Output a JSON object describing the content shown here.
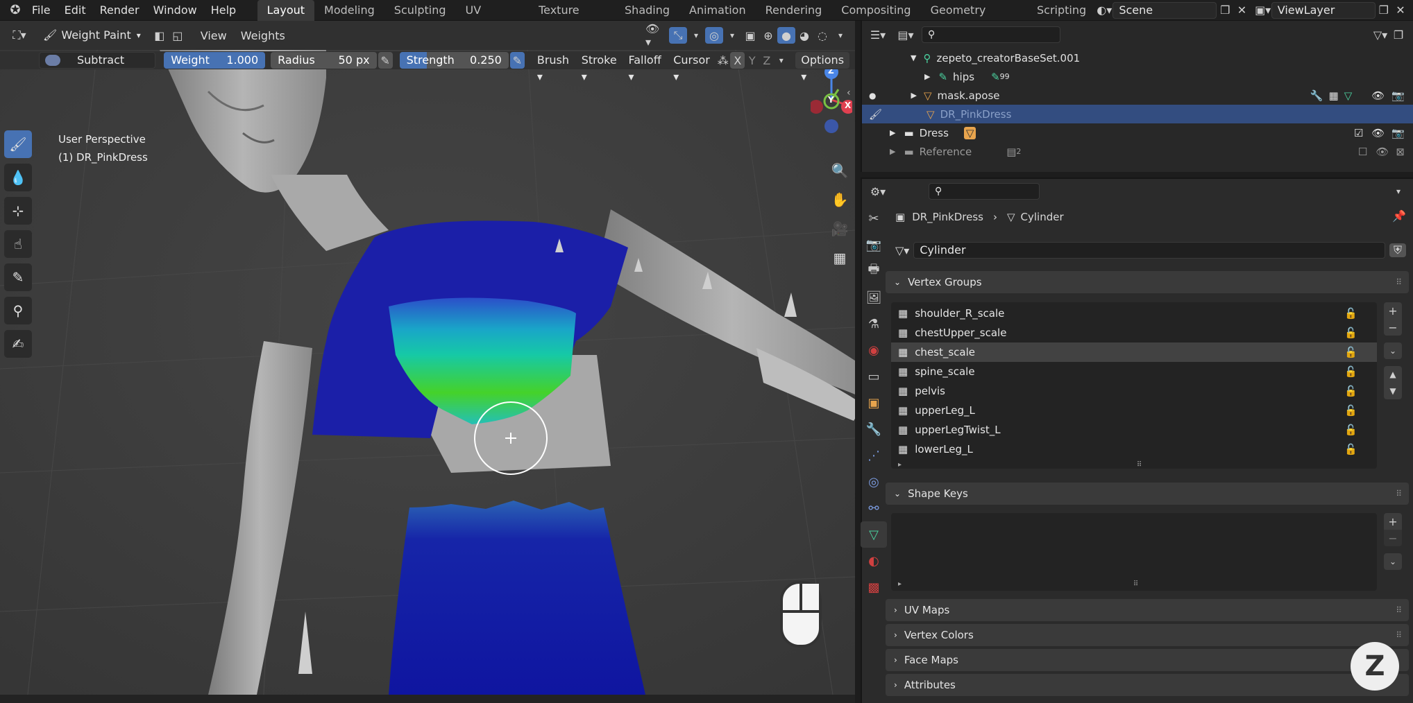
{
  "topbar": {
    "menus": [
      "File",
      "Edit",
      "Render",
      "Window",
      "Help"
    ],
    "workspaces": [
      "Layout",
      "Modeling",
      "Sculpting",
      "UV Editing",
      "Texture Paint",
      "Shading",
      "Animation",
      "Rendering",
      "Compositing",
      "Geometry Nodes",
      "Scripting"
    ],
    "scene": "Scene",
    "view_layer": "ViewLayer"
  },
  "viewport_header": {
    "mode": "Weight Paint",
    "menus": [
      "View",
      "Weights"
    ]
  },
  "tool_settings": {
    "blend": "Subtract",
    "weight_label": "Weight",
    "weight_value": "1.000",
    "radius_label": "Radius",
    "radius_value": "50 px",
    "strength_label": "Strength",
    "strength_value": "0.250",
    "dropdowns": [
      "Brush",
      "Stroke",
      "Falloff",
      "Cursor"
    ],
    "axes": [
      "X",
      "Y",
      "Z"
    ],
    "options": "Options"
  },
  "viewport": {
    "perspective": "User Perspective",
    "object": "(1) DR_PinkDress",
    "gizmo_axes": {
      "z": "Z",
      "y": "Y",
      "x": "X"
    }
  },
  "outliner": {
    "rows": [
      {
        "label": "zepeto_creatorBaseSet.001"
      },
      {
        "label": "hips",
        "badge": "99"
      },
      {
        "label": "mask.apose"
      },
      {
        "label": "DR_PinkDress"
      },
      {
        "label": "Dress"
      },
      {
        "label": "Reference",
        "badge": "2"
      }
    ]
  },
  "properties": {
    "breadcrumb_object": "DR_PinkDress",
    "breadcrumb_data": "Cylinder",
    "data_name": "Cylinder",
    "vertex_groups_title": "Vertex Groups",
    "vertex_groups": [
      "shoulder_R_scale",
      "chestUpper_scale",
      "chest_scale",
      "spine_scale",
      "pelvis",
      "upperLeg_L",
      "upperLegTwist_L",
      "lowerLeg_L"
    ],
    "selected_group_index": 2,
    "panels": [
      "Shape Keys",
      "UV Maps",
      "Vertex Colors",
      "Face Maps",
      "Attributes"
    ]
  },
  "colors": {
    "accent": "#4772b3",
    "selected_row": "#334d80",
    "dress_blue": "#1a1fa8",
    "paint_green": "#3ecf2a"
  }
}
